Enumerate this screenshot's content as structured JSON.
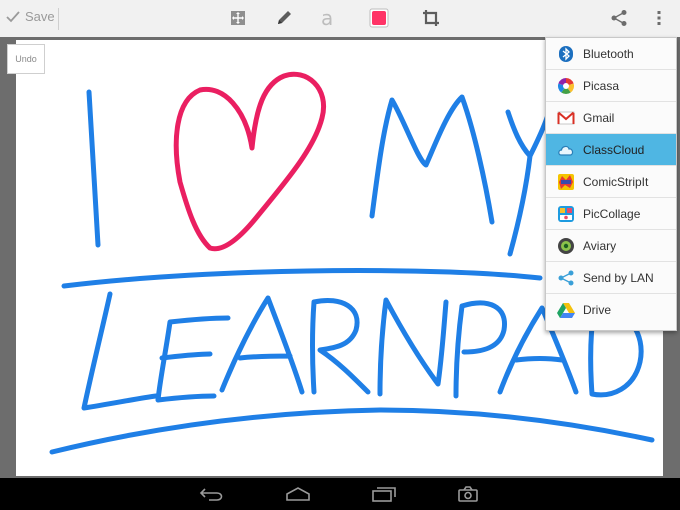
{
  "toolbar": {
    "save_label": "Save",
    "selected_color": "#ff3366",
    "tools": [
      "move-icon",
      "pencil-icon",
      "text-icon",
      "color-swatch",
      "crop-icon"
    ],
    "actions": [
      "share-icon",
      "overflow-menu-icon"
    ]
  },
  "canvas": {
    "undo_label": "Undo",
    "ink_blue": "#1f7fe6",
    "ink_red": "#ea1f61"
  },
  "share_menu": {
    "items": [
      {
        "label": "Bluetooth",
        "icon": "bluetooth-icon"
      },
      {
        "label": "Picasa",
        "icon": "picasa-icon"
      },
      {
        "label": "Gmail",
        "icon": "gmail-icon"
      },
      {
        "label": "ClassCloud",
        "icon": "cloud-icon",
        "selected": true
      },
      {
        "label": "ComicStripIt",
        "icon": "comicstripit-icon"
      },
      {
        "label": "PicCollage",
        "icon": "piccollage-icon"
      },
      {
        "label": "Aviary",
        "icon": "aviary-icon"
      },
      {
        "label": "Send by LAN",
        "icon": "share-lan-icon"
      },
      {
        "label": "Drive",
        "icon": "drive-icon"
      }
    ]
  },
  "navbar": [
    "back-icon",
    "home-icon",
    "recent-apps-icon",
    "screenshot-icon"
  ]
}
